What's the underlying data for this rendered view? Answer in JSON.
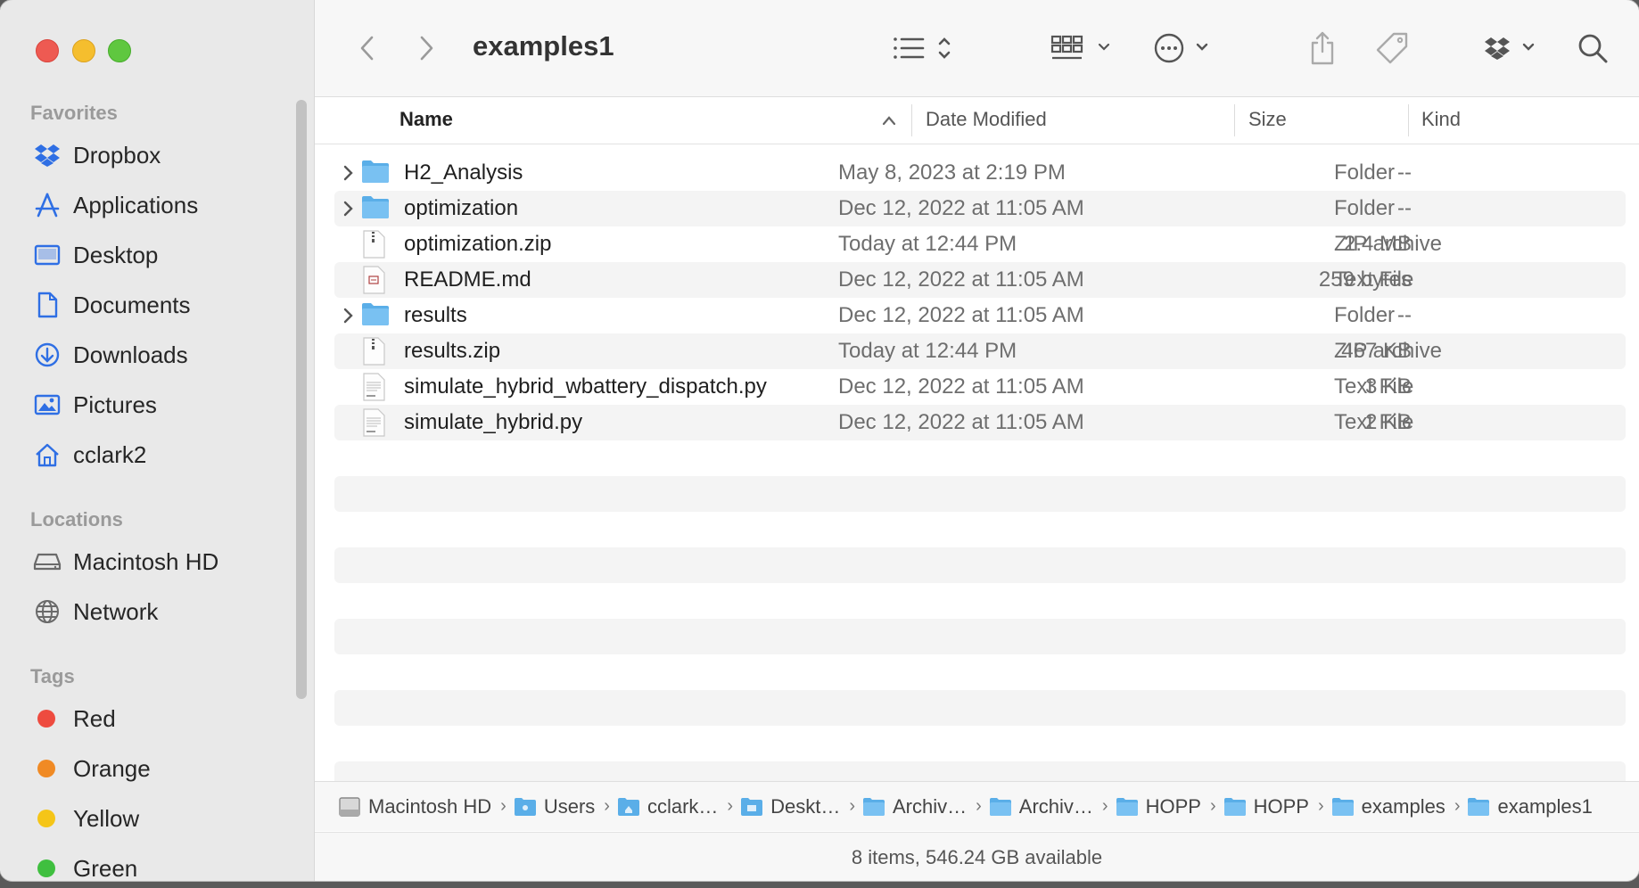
{
  "window": {
    "title": "examples1"
  },
  "sidebar": {
    "favorites_label": "Favorites",
    "favorites": [
      {
        "label": "Dropbox",
        "icon": "dropbox-icon"
      },
      {
        "label": "Applications",
        "icon": "applications-icon"
      },
      {
        "label": "Desktop",
        "icon": "desktop-icon"
      },
      {
        "label": "Documents",
        "icon": "document-icon"
      },
      {
        "label": "Downloads",
        "icon": "download-icon"
      },
      {
        "label": "Pictures",
        "icon": "photo-icon"
      },
      {
        "label": "cclark2",
        "icon": "home-icon"
      }
    ],
    "locations_label": "Locations",
    "locations": [
      {
        "label": "Macintosh HD",
        "icon": "drive-icon"
      },
      {
        "label": "Network",
        "icon": "globe-icon"
      }
    ],
    "tags_label": "Tags",
    "tags": [
      {
        "label": "Red",
        "color": "#ee4b3f"
      },
      {
        "label": "Orange",
        "color": "#f08a24"
      },
      {
        "label": "Yellow",
        "color": "#f5c518"
      },
      {
        "label": "Green",
        "color": "#3fbf3f"
      }
    ]
  },
  "columns": {
    "name": "Name",
    "date": "Date Modified",
    "size": "Size",
    "kind": "Kind"
  },
  "files": [
    {
      "name": "H2_Analysis",
      "date": "May 8, 2023 at 2:19 PM",
      "size": "--",
      "kind": "Folder",
      "type": "folder"
    },
    {
      "name": "optimization",
      "date": "Dec 12, 2022 at 11:05 AM",
      "size": "--",
      "kind": "Folder",
      "type": "folder"
    },
    {
      "name": "optimization.zip",
      "date": "Today at 12:44 PM",
      "size": "2.4 MB",
      "kind": "ZIP archive",
      "type": "zip"
    },
    {
      "name": "README.md",
      "date": "Dec 12, 2022 at 11:05 AM",
      "size": "259 bytes",
      "kind": "Text File",
      "type": "md"
    },
    {
      "name": "results",
      "date": "Dec 12, 2022 at 11:05 AM",
      "size": "--",
      "kind": "Folder",
      "type": "folder"
    },
    {
      "name": "results.zip",
      "date": "Today at 12:44 PM",
      "size": "467 KB",
      "kind": "ZIP archive",
      "type": "zip"
    },
    {
      "name": "simulate_hybrid_wbattery_dispatch.py",
      "date": "Dec 12, 2022 at 11:05 AM",
      "size": "3 KB",
      "kind": "Text File",
      "type": "py"
    },
    {
      "name": "simulate_hybrid.py",
      "date": "Dec 12, 2022 at 11:05 AM",
      "size": "2 KB",
      "kind": "Text File",
      "type": "py"
    }
  ],
  "pathbar": [
    {
      "label": "Macintosh HD",
      "type": "drive"
    },
    {
      "label": "Users",
      "type": "users"
    },
    {
      "label": "cclark…",
      "type": "home"
    },
    {
      "label": "Deskt…",
      "type": "desktop"
    },
    {
      "label": "Archiv…",
      "type": "folder"
    },
    {
      "label": "Archiv…",
      "type": "folder"
    },
    {
      "label": "HOPP",
      "type": "folder"
    },
    {
      "label": "HOPP",
      "type": "folder"
    },
    {
      "label": "examples",
      "type": "folder"
    },
    {
      "label": "examples1",
      "type": "folder"
    }
  ],
  "status": "8 items, 546.24 GB available"
}
